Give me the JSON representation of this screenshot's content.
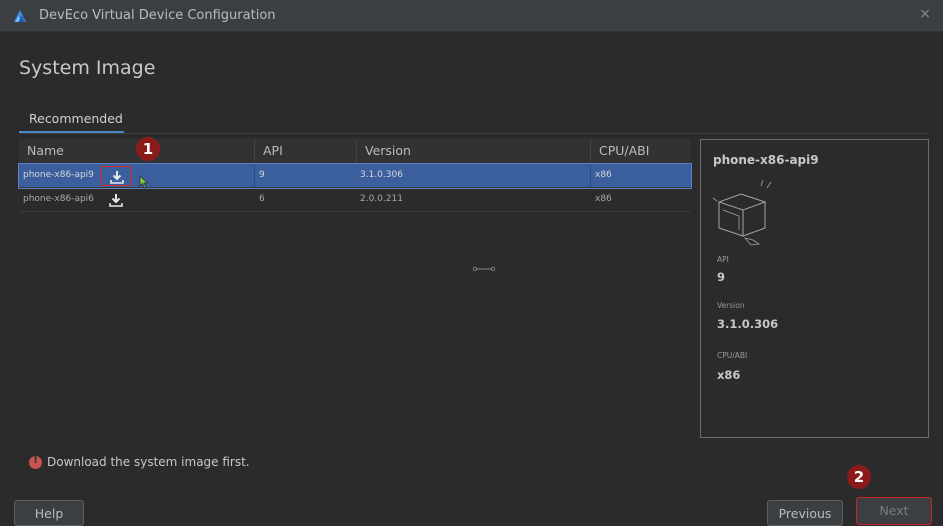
{
  "window": {
    "title": "DevEco Virtual Device Configuration",
    "close_label": "×"
  },
  "page": {
    "title": "System Image"
  },
  "tabs": [
    {
      "label": "Recommended",
      "active": true
    }
  ],
  "table": {
    "columns": [
      "Name",
      "API",
      "Version",
      "CPU/ABI"
    ],
    "rows": [
      {
        "name": "phone-x86-api9",
        "api": "9",
        "version": "3.1.0.306",
        "cpu": "x86",
        "selected": true
      },
      {
        "name": "phone-x86-api6",
        "api": "6",
        "version": "2.0.0.211",
        "cpu": "x86",
        "selected": false
      }
    ]
  },
  "details": {
    "name": "phone-x86-api9",
    "api_label": "API",
    "api_value": "9",
    "version_label": "Version",
    "version_value": "3.1.0.306",
    "cpu_label": "CPU/ABI",
    "cpu_value": "x86"
  },
  "status": {
    "error_message": "Download the system image first."
  },
  "buttons": {
    "help": "Help",
    "previous": "Previous",
    "next": "Next"
  },
  "annotations": {
    "step1": "1",
    "step2": "2"
  },
  "colors": {
    "accent": "#4a88c7",
    "selection": "#3b5f9c",
    "highlight_red": "#d8262b",
    "badge": "#8b1b1b",
    "error": "#c75450"
  },
  "icons": {
    "app": "deveco-logo-icon",
    "download": "download-icon",
    "error": "error-icon",
    "cursor": "mouse-cursor-icon"
  }
}
